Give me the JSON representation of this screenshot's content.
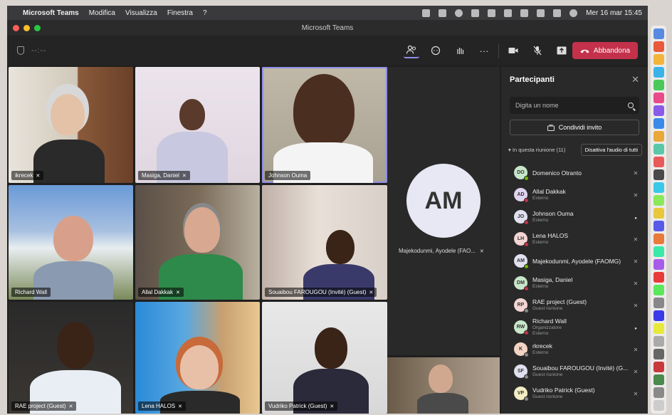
{
  "menubar": {
    "app_name": "Microsoft Teams",
    "menus": [
      "Modifica",
      "Visualizza",
      "Finestra",
      "?"
    ],
    "datetime": "Mer 16 mar  15:45"
  },
  "window": {
    "title": "Microsoft Teams"
  },
  "toolbar": {
    "timer": "--:--",
    "leave_label": "Abbandona"
  },
  "tiles": [
    {
      "label": "ikrecek"
    },
    {
      "label": "Masiga, Daniel"
    },
    {
      "label": "Johnson Ouma"
    },
    {
      "label": "Richard Wall"
    },
    {
      "label": "Allal Dakkak"
    },
    {
      "label": "Souaibou FAROUGOU (Invité) (Guest)"
    },
    {
      "label": "RAE project (Guest)"
    },
    {
      "label": "Lena HALOS"
    },
    {
      "label": "Vudriko Patrick (Guest)"
    }
  ],
  "am_tile": {
    "initials": "AM",
    "label": "Majekodunmi, Ayodele (FAO..."
  },
  "panel": {
    "title": "Partecipanti",
    "search_placeholder": "Digita un nome",
    "invite_label": "Condividi invito",
    "section_label": "In questa riunione (11)",
    "mute_all_label": "Disattiva l'audio di tutti",
    "participants": [
      {
        "initials": "DO",
        "name": "Domenico Otranto",
        "sub": "",
        "color": "#c8e6c9",
        "dot": "#6bb700",
        "mic": "muted"
      },
      {
        "initials": "AD",
        "name": "Allal Dakkak",
        "sub": "Esterno",
        "color": "#e0d4f0",
        "dot": "#c4314b",
        "mic": "muted"
      },
      {
        "initials": "JO",
        "name": "Johnson Ouma",
        "sub": "Esterno",
        "color": "#e0e0f0",
        "dot": "#c4314b",
        "mic": "on"
      },
      {
        "initials": "LH",
        "name": "Lena HALOS",
        "sub": "Esterno",
        "color": "#f4d4d4",
        "dot": "#c4314b",
        "mic": "muted"
      },
      {
        "initials": "AM",
        "name": "Majekodunmi, Ayodele (FAOMG)",
        "sub": "",
        "color": "#e0e0f0",
        "dot": "#6bb700",
        "mic": "muted"
      },
      {
        "initials": "DM",
        "name": "Masiga, Daniel",
        "sub": "Esterno",
        "color": "#c8e6c9",
        "dot": "#c4314b",
        "mic": "muted"
      },
      {
        "initials": "RP",
        "name": "RAE project (Guest)",
        "sub": "Guest riunione",
        "color": "#f4d4d4",
        "dot": "#8a8886",
        "mic": "muted"
      },
      {
        "initials": "RW",
        "name": "Richard Wall",
        "sub": "Organizzatore\nEsterno",
        "color": "#c8e6c9",
        "dot": "#c4314b",
        "mic": "on"
      },
      {
        "initials": "K",
        "name": "rkrecek",
        "sub": "Esterno",
        "color": "#f4d4c4",
        "dot": "#8a8886",
        "mic": "muted"
      },
      {
        "initials": "SF",
        "name": "Souaibou FAROUGOU (Invité) (G...",
        "sub": "Guest riunione",
        "color": "#e0e0f0",
        "dot": "#8a8886",
        "mic": "muted"
      },
      {
        "initials": "VP",
        "name": "Vudriko Patrick (Guest)",
        "sub": "Guest riunione",
        "color": "#f4ecc4",
        "dot": "#8a8886",
        "mic": "muted"
      }
    ]
  }
}
